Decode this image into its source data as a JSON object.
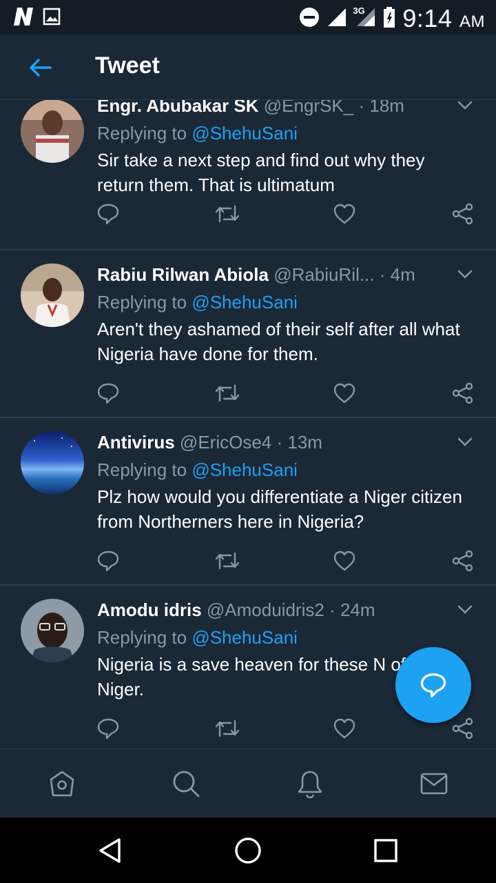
{
  "status_bar": {
    "time": "9:14",
    "ampm": "AM",
    "network": "3G"
  },
  "header": {
    "title": "Tweet"
  },
  "tweets": [
    {
      "name": "Engr. Abubakar SK",
      "handle": "@EngrSK_",
      "time": "18m",
      "replying_prefix": "Replying to ",
      "replying_to": "@ShehuSani",
      "text": "Sir take a next step and find out why they return them. That is ultimatum"
    },
    {
      "name": "Rabiu Rilwan Abiola",
      "handle": "@RabiuRil...",
      "time": "4m",
      "replying_prefix": "Replying to ",
      "replying_to": "@ShehuSani",
      "text": "Aren't they ashamed of their self after all what Nigeria have done for them."
    },
    {
      "name": "Antivirus",
      "handle": "@EricOse4",
      "time": "13m",
      "replying_prefix": "Replying to ",
      "replying_to": "@ShehuSani",
      "text": "Plz how would you differentiate a Niger citizen from Northerners here in Nigeria?"
    },
    {
      "name": "Amodu idris",
      "handle": "@Amoduidris2",
      "time": "24m",
      "replying_prefix": "Replying to ",
      "replying_to": "@ShehuSani",
      "text": "Nigeria is a save heaven for these N of Niger."
    }
  ],
  "colors": {
    "background": "#1b2836",
    "accent": "#1da1f2",
    "muted": "#8899a6",
    "divider": "#2f3e4d"
  },
  "icons": {
    "tweet_actions": [
      "reply-icon",
      "retweet-icon",
      "like-icon",
      "share-icon"
    ],
    "tab_bar": [
      "home-icon",
      "search-icon",
      "notifications-icon",
      "messages-icon"
    ],
    "nav_bar": [
      "back-triangle-icon",
      "home-circle-icon",
      "recents-square-icon"
    ],
    "fab": "compose-reply-icon"
  }
}
